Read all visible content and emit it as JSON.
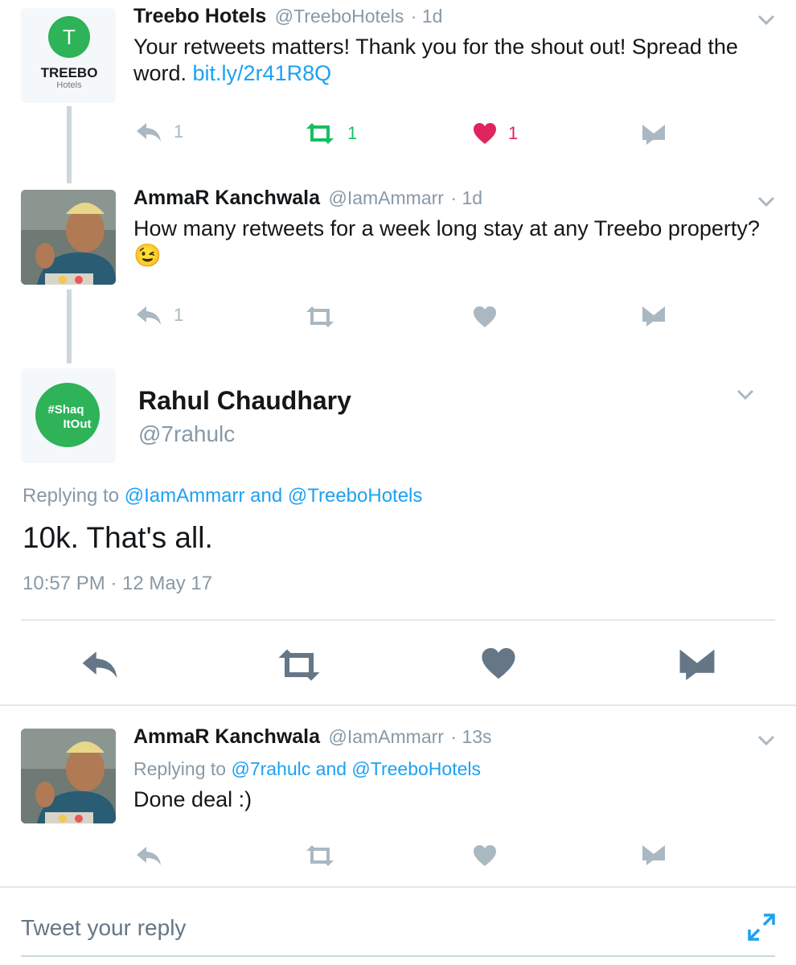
{
  "tweets": [
    {
      "name": "Treebo Hotels",
      "handle": "@TreeboHotels",
      "time": "· 1d",
      "text_prefix": "Your retweets matters! Thank you for the shout out! Spread the word. ",
      "link": "bit.ly/2r41R8Q",
      "avatar_brand": "TREEBO",
      "avatar_sub": "Hotels",
      "avatar_glyph": "T",
      "reply_count": "1",
      "retweet_count": "1",
      "like_count": "1"
    },
    {
      "name": "AmmaR Kanchwala",
      "handle": "@IamAmmarr",
      "time": "· 1d",
      "text": "How many retweets for a week long stay at any Treebo property?",
      "emoji": "😉",
      "reply_count": "1"
    }
  ],
  "main_tweet": {
    "name": "Rahul Chaudhary",
    "handle": "@7rahulc",
    "avatar_text_1": "#Shaq",
    "avatar_text_2": "ItOut",
    "replying_label": "Replying to",
    "replying_user1": "@IamAmmarr",
    "replying_and": "and",
    "replying_user2": "@TreeboHotels",
    "text": "10k. That's all.",
    "timestamp": "10:57 PM · 12 May 17"
  },
  "reply_tweet": {
    "name": "AmmaR Kanchwala",
    "handle": "@IamAmmarr",
    "time": "· 13s",
    "replying_label": "Replying to",
    "replying_user1": "@7rahulc",
    "replying_and": "and",
    "replying_user2": "@TreeboHotels",
    "text": "Done deal :)"
  },
  "composer": {
    "placeholder": "Tweet your reply"
  },
  "colors": {
    "link": "#1da1f2",
    "retweet_active": "#17bf63",
    "like_active": "#e0245e",
    "icon_inactive": "#aab8c2",
    "icon_dark": "#657786",
    "treebo_green": "#2eb358"
  },
  "icons": [
    "reply-icon",
    "retweet-icon",
    "heart-icon",
    "dm-icon",
    "chevron-down-icon",
    "expand-icon"
  ]
}
